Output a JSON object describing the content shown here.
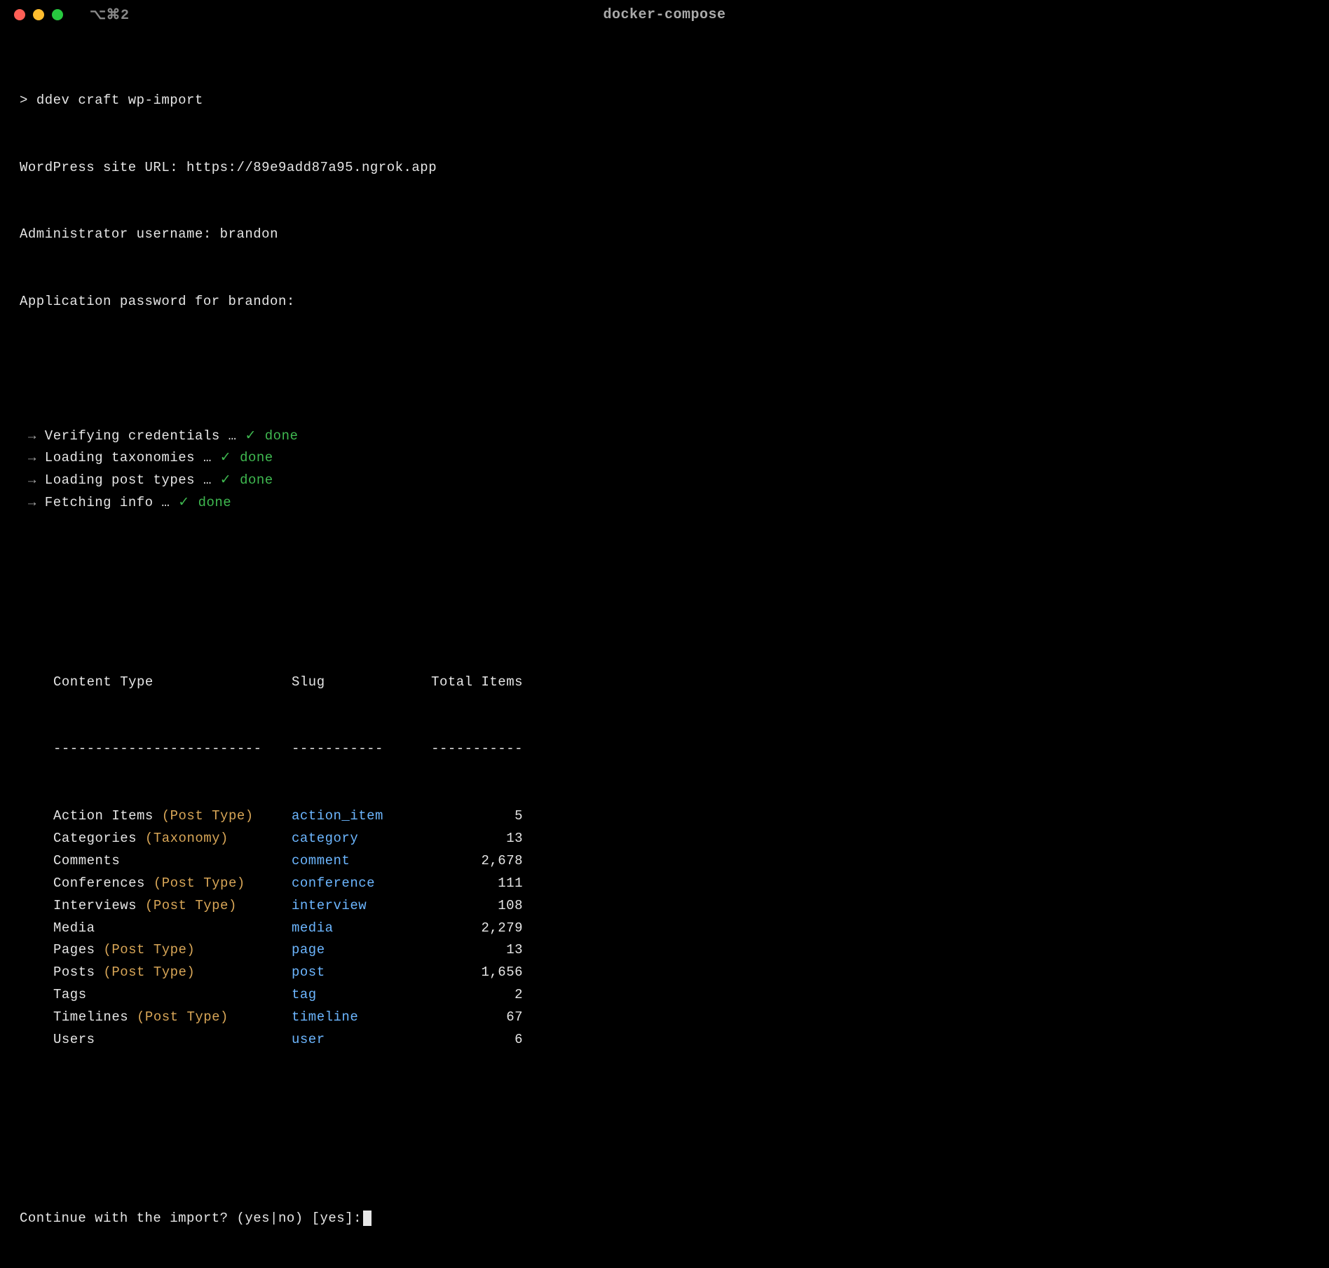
{
  "window": {
    "shortcut": "⌥⌘2",
    "title": "docker-compose"
  },
  "prompt": {
    "symbol": ">",
    "command": "ddev craft wp-import"
  },
  "inputs": {
    "site_url_label": "WordPress site URL:",
    "site_url_value": "https://89e9add87a95.ngrok.app",
    "admin_user_label": "Administrator username:",
    "admin_user_value": "brandon",
    "password_label": "Application password for brandon:"
  },
  "steps": [
    {
      "arrow": "→",
      "label": "Verifying credentials …",
      "check": "✓",
      "done": "done"
    },
    {
      "arrow": "→",
      "label": "Loading taxonomies …",
      "check": "✓",
      "done": "done"
    },
    {
      "arrow": "→",
      "label": "Loading post types …",
      "check": "✓",
      "done": "done"
    },
    {
      "arrow": "→",
      "label": "Fetching info …",
      "check": "✓",
      "done": "done"
    }
  ],
  "table": {
    "headers": {
      "type": "Content Type",
      "slug": "Slug",
      "total": "Total Items"
    },
    "dividers": {
      "type": "-------------------------",
      "slug": "-----------",
      "total": "-----------"
    },
    "rows": [
      {
        "name": "Action Items",
        "kind": "(Post Type)",
        "slug": "action_item",
        "total": "5"
      },
      {
        "name": "Categories",
        "kind": "(Taxonomy)",
        "slug": "category",
        "total": "13"
      },
      {
        "name": "Comments",
        "kind": "",
        "slug": "comment",
        "total": "2,678"
      },
      {
        "name": "Conferences",
        "kind": "(Post Type)",
        "slug": "conference",
        "total": "111"
      },
      {
        "name": "Interviews",
        "kind": "(Post Type)",
        "slug": "interview",
        "total": "108"
      },
      {
        "name": "Media",
        "kind": "",
        "slug": "media",
        "total": "2,279"
      },
      {
        "name": "Pages",
        "kind": "(Post Type)",
        "slug": "page",
        "total": "13"
      },
      {
        "name": "Posts",
        "kind": "(Post Type)",
        "slug": "post",
        "total": "1,656"
      },
      {
        "name": "Tags",
        "kind": "",
        "slug": "tag",
        "total": "2"
      },
      {
        "name": "Timelines",
        "kind": "(Post Type)",
        "slug": "timeline",
        "total": "67"
      },
      {
        "name": "Users",
        "kind": "",
        "slug": "user",
        "total": "6"
      }
    ]
  },
  "confirm": {
    "question": "Continue with the import? (yes|no) [yes]:"
  }
}
